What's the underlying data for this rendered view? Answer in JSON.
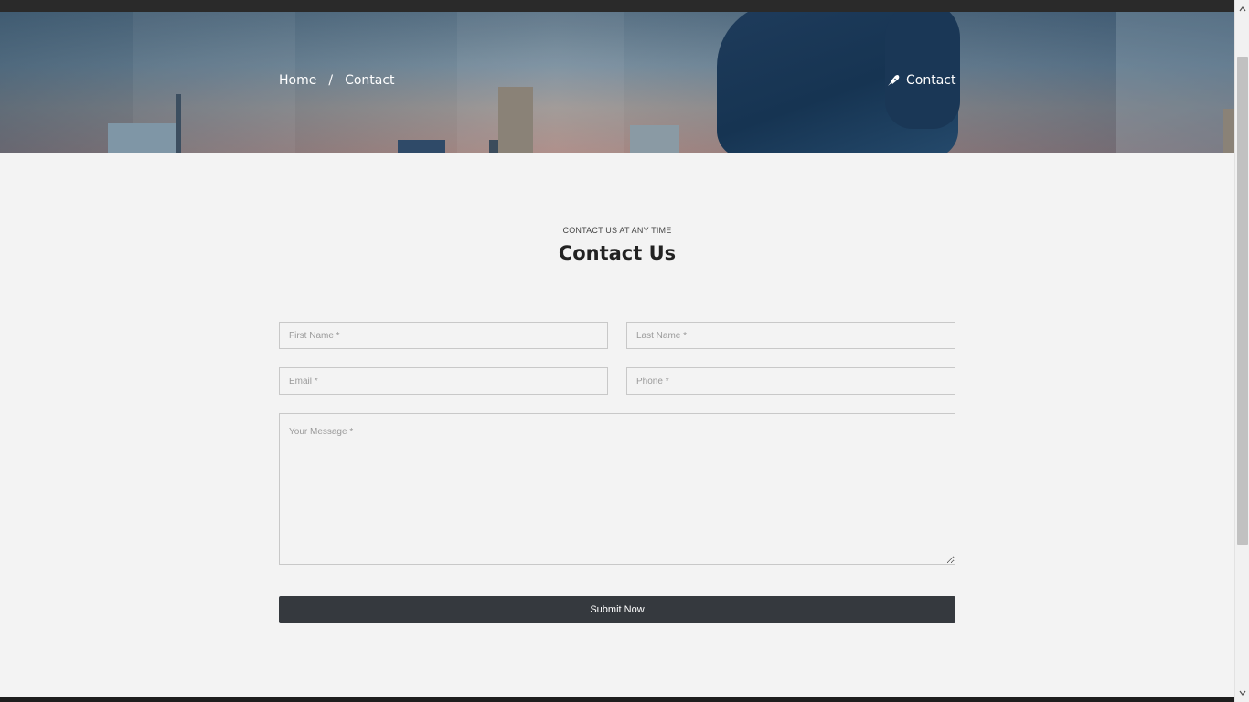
{
  "breadcrumb": {
    "home": "Home",
    "separator": "/",
    "current": "Contact"
  },
  "header": {
    "page_label": "Contact",
    "page_icon": "pen-nib-icon"
  },
  "section": {
    "subtitle": "CONTACT US AT ANY TIME",
    "title": "Contact Us"
  },
  "form": {
    "first_name_placeholder": "First Name *",
    "last_name_placeholder": "Last Name *",
    "email_placeholder": "Email *",
    "phone_placeholder": "Phone *",
    "message_placeholder": "Your Message *",
    "submit_label": "Submit Now"
  },
  "colors": {
    "button_bg": "#35393e",
    "page_bg": "#f3f3f3",
    "field_border": "#c8c8c8"
  }
}
